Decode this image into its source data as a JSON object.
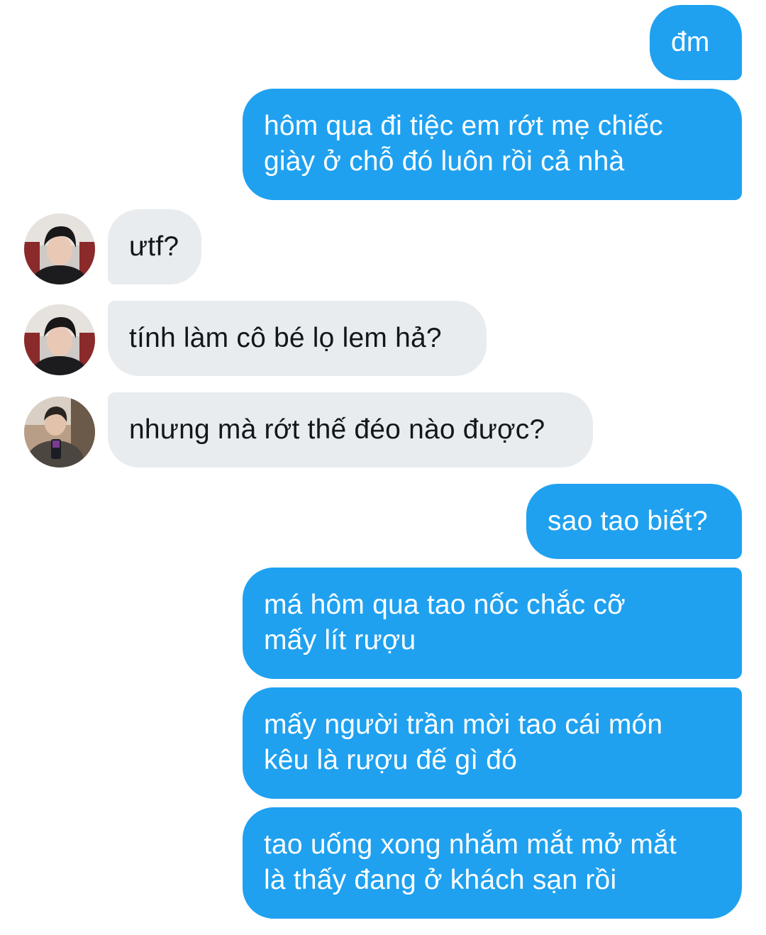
{
  "messages": [
    {
      "sender": "me",
      "text": "đm"
    },
    {
      "sender": "me",
      "text": "hôm qua đi tiệc em rớt mẹ chiếc\ngiày ở chỗ đó luôn rồi cả nhà"
    },
    {
      "sender": "user_a",
      "text": "ưtf?"
    },
    {
      "sender": "user_a",
      "text": "tính làm cô bé lọ lem hả?"
    },
    {
      "sender": "user_b",
      "text": "nhưng mà rớt thế đéo nào được?"
    },
    {
      "sender": "me",
      "text": "sao tao biết?"
    },
    {
      "sender": "me",
      "text": "má hôm qua tao nốc chắc cỡ\nmấy lít rượu"
    },
    {
      "sender": "me",
      "text": "mấy người trần mời tao cái món\nkêu là rượu đế gì đó"
    },
    {
      "sender": "me",
      "text": "tao uống xong nhắm mắt mở mắt\nlà thấy đang ở khách sạn rồi"
    }
  ],
  "colors": {
    "outgoing_bubble": "#1fa1f0",
    "outgoing_text": "#ffffff",
    "incoming_bubble": "#e8ecef",
    "incoming_text": "#14171a",
    "background": "#ffffff"
  },
  "avatars": {
    "user_a": "avatar-photo-dark-hair-boy",
    "user_b": "avatar-photo-jacket-phone"
  }
}
